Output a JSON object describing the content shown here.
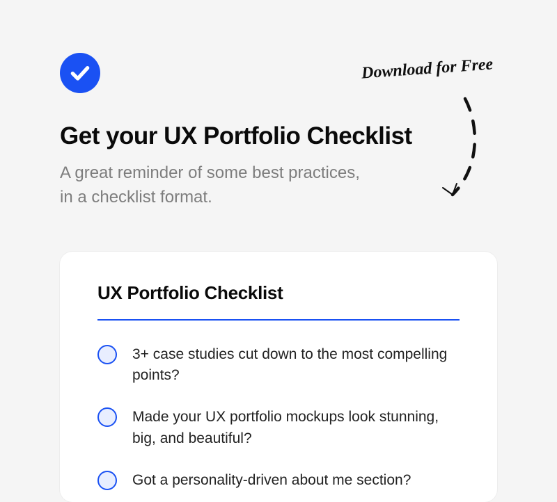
{
  "heading": "Get your UX Portfolio Checklist",
  "subheading_line1": "A great reminder of some best practices,",
  "subheading_line2": "in a checklist format.",
  "handwritten": "Download for Free",
  "card": {
    "title": "UX Portfolio Checklist",
    "items": [
      "3+ case studies cut down to the most compelling points?",
      "Made your UX portfolio mockups look stunning, big, and beautiful?",
      "Got a personality-driven about me section?"
    ]
  },
  "colors": {
    "accent": "#1a51f3"
  }
}
